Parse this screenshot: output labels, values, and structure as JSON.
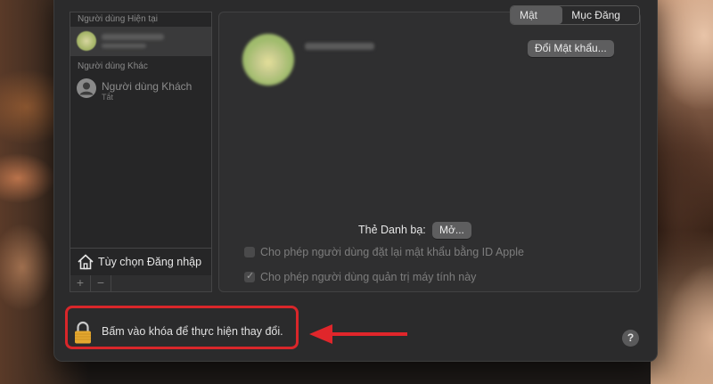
{
  "sidebar": {
    "current_header": "Người dùng Hiện tại",
    "other_header": "Người dùng Khác",
    "guest_name": "Người dùng Khách",
    "guest_status": "Tắt",
    "login_options": "Tùy chọn Đăng nhập",
    "add_label": "+",
    "remove_label": "−"
  },
  "tabs": {
    "password": "Mật khẩu",
    "login_items": "Mục Đăng nhập"
  },
  "main": {
    "change_password_button": "Đổi Mật khẩu...",
    "contact_card_label": "Thẻ Danh bạ:",
    "open_button": "Mở...",
    "checkbox_reset_apple_id": "Cho phép người dùng đặt lại mật khẩu bằng ID Apple",
    "checkbox_admin": "Cho phép người dùng quản trị máy tính này"
  },
  "footer": {
    "lock_text": "Bấm vào khóa để thực hiện thay đổi.",
    "help_label": "?"
  },
  "colors": {
    "highlight": "#d9262a"
  },
  "icons": [
    "house-icon",
    "user-icon",
    "lock-icon",
    "help-icon",
    "arrow-icon"
  ]
}
